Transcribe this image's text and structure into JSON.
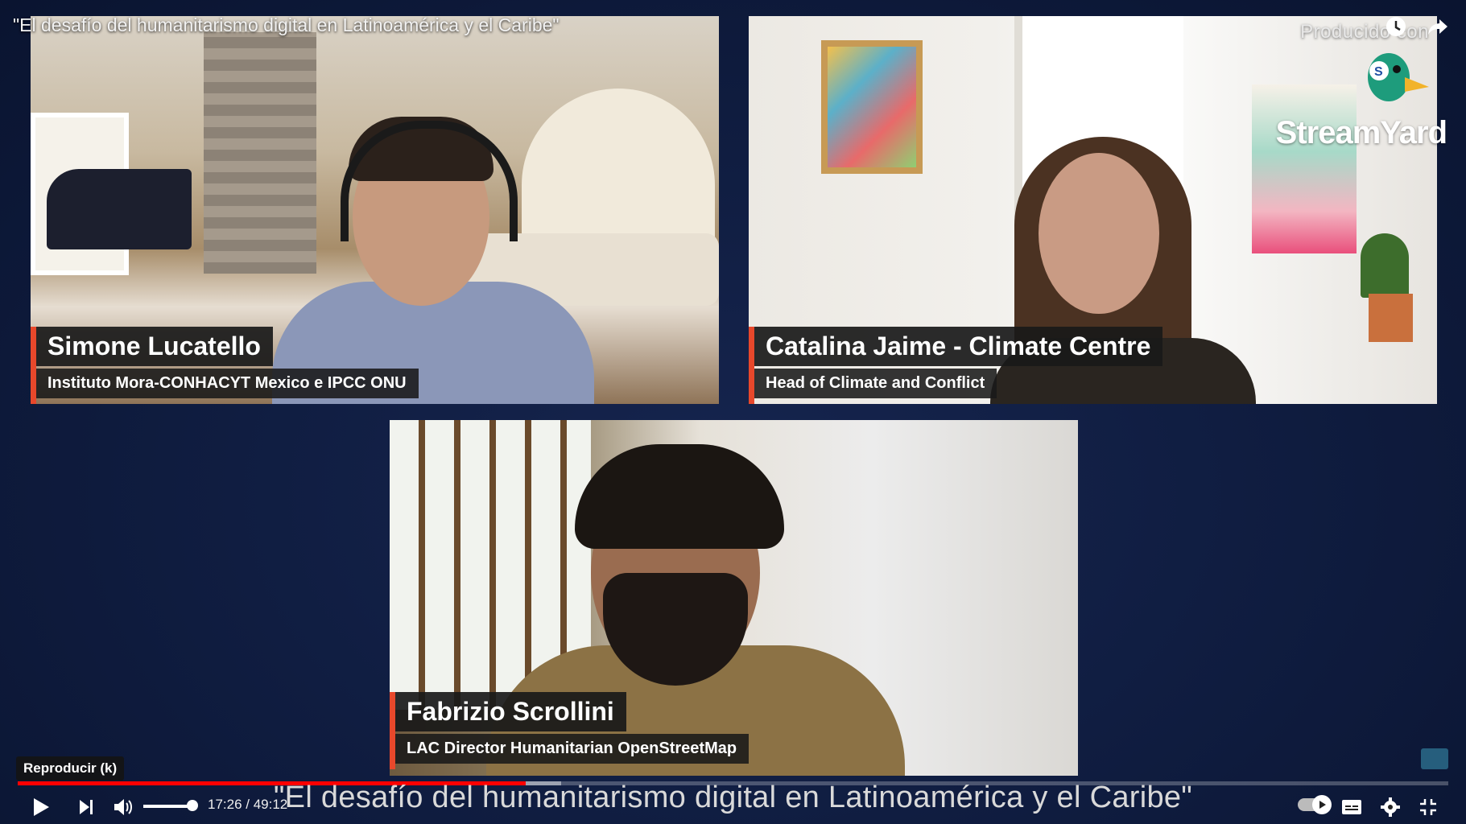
{
  "video": {
    "title": "\"El desafío del humanitarismo digital en Latinoamérica y el Caribe\"",
    "caption": "\"El desafío del humanitarismo digital en Latinoamérica y el Caribe\""
  },
  "branding": {
    "producido": "Producido con",
    "logo_text": "StreamYard"
  },
  "participants": [
    {
      "name": "Simone Lucatello",
      "role": "Instituto Mora-CONHACYT Mexico e IPCC ONU"
    },
    {
      "name": "Catalina Jaime - Climate Centre",
      "role": "Head of Climate and Conflict"
    },
    {
      "name": "Fabrizio Scrollini",
      "role": "LAC Director Humanitarian OpenStreetMap"
    }
  ],
  "player": {
    "tooltip": "Reproducir (k)",
    "current_time": "17:26",
    "duration": "49:12",
    "time_display": "17:26 / 49:12",
    "progress_fraction": 0.355,
    "buffered_fraction": 0.38,
    "volume_fraction": 0.9
  },
  "colors": {
    "accent": "#e8482b",
    "progress": "#ff0000",
    "background": "#0f1c3f"
  },
  "icons": [
    "watch-later-icon",
    "share-icon",
    "play-icon",
    "next-icon",
    "volume-icon",
    "autoplay-toggle",
    "subtitles-icon",
    "settings-icon",
    "exit-fullscreen-icon"
  ]
}
